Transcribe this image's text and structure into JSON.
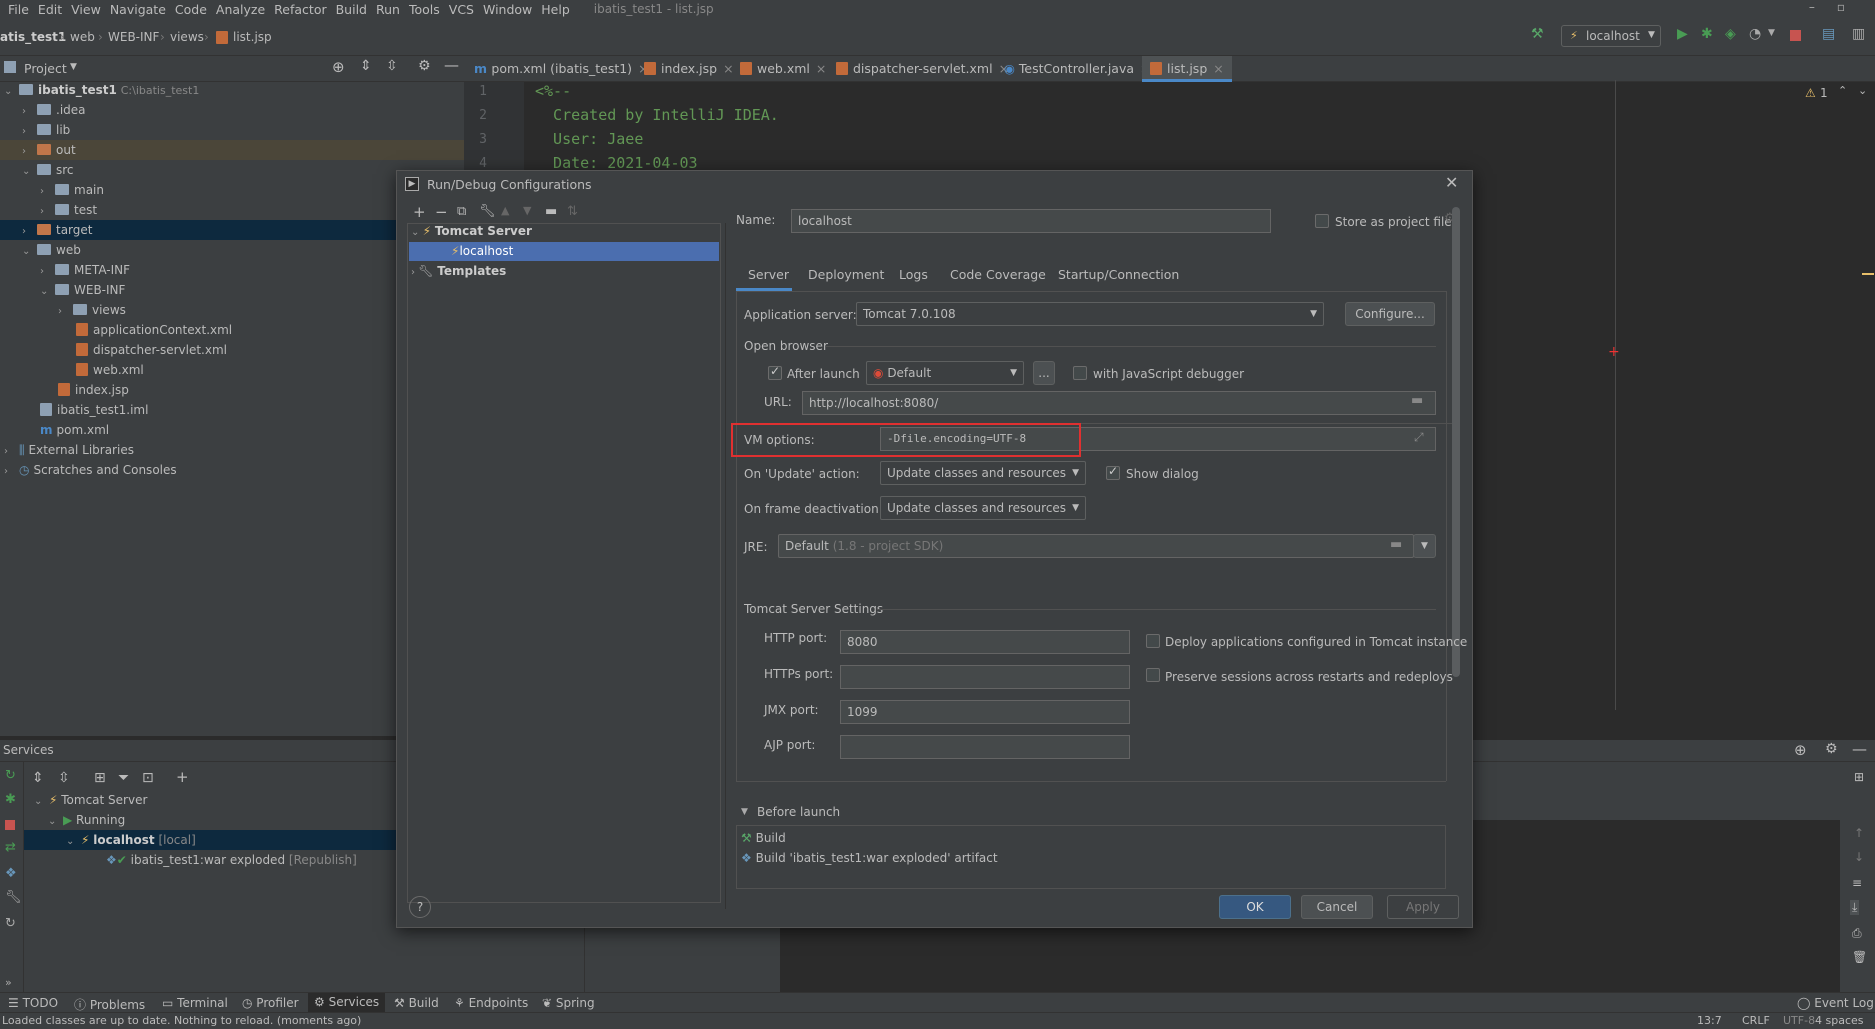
{
  "menu": [
    "File",
    "Edit",
    "View",
    "Navigate",
    "Code",
    "Analyze",
    "Refactor",
    "Build",
    "Run",
    "Tools",
    "VCS",
    "Window",
    "Help"
  ],
  "window_title": "ibatis_test1 - list.jsp",
  "breadcrumbs": [
    "atis_test1",
    "web",
    "WEB-INF",
    "views",
    "list.jsp"
  ],
  "run_config": "localhost",
  "project": {
    "title": "Project",
    "tree": [
      {
        "label": "ibatis_test1",
        "hint": "C:\\ibatis_test1"
      },
      {
        "label": ".idea"
      },
      {
        "label": "lib"
      },
      {
        "label": "out"
      },
      {
        "label": "src"
      },
      {
        "label": "main"
      },
      {
        "label": "test"
      },
      {
        "label": "target"
      },
      {
        "label": "web"
      },
      {
        "label": "META-INF"
      },
      {
        "label": "WEB-INF"
      },
      {
        "label": "views"
      },
      {
        "label": "applicationContext.xml"
      },
      {
        "label": "dispatcher-servlet.xml"
      },
      {
        "label": "web.xml"
      },
      {
        "label": "index.jsp"
      },
      {
        "label": "ibatis_test1.iml"
      },
      {
        "label": "pom.xml"
      },
      {
        "label": "External Libraries"
      },
      {
        "label": "Scratches and Consoles"
      }
    ]
  },
  "editor_tabs": [
    "pom.xml (ibatis_test1)",
    "index.jsp",
    "web.xml",
    "dispatcher-servlet.xml",
    "TestController.java",
    "list.jsp"
  ],
  "code_lines": [
    {
      "n": "1",
      "text": "<%--"
    },
    {
      "n": "2",
      "text": "  Created by IntelliJ IDEA."
    },
    {
      "n": "3",
      "text": "  User: Jaee"
    },
    {
      "n": "4",
      "text": "  Date: 2021-04-03"
    }
  ],
  "warning_count": "1",
  "services": {
    "title": "Services",
    "tree": [
      {
        "label": "Tomcat Server",
        "hint": ""
      },
      {
        "label": "Running",
        "hint": ""
      },
      {
        "label": "localhost",
        "hint": "[local]"
      },
      {
        "label": "ibatis_test1:war exploded",
        "hint": "[Republish]"
      }
    ]
  },
  "bottom_tools": [
    "TODO",
    "Problems",
    "Terminal",
    "Profiler",
    "Services",
    "Build",
    "Endpoints",
    "Spring"
  ],
  "event_log": "Event Log",
  "status": {
    "message": "Loaded classes are up to date. Nothing to reload. (moments ago)",
    "position": "13:7",
    "line_sep": "CRLF",
    "encoding": "UTF-8",
    "indent": "4 spaces"
  },
  "dialog": {
    "title": "Run/Debug Configurations",
    "left_tree": {
      "group": "Tomcat Server",
      "item": "localhost",
      "templates": "Templates"
    },
    "name_label": "Name:",
    "name_value": "localhost",
    "store_label": "Store as project file",
    "tabs": [
      "Server",
      "Deployment",
      "Logs",
      "Code Coverage",
      "Startup/Connection"
    ],
    "app_server_label": "Application server:",
    "app_server_value": "Tomcat 7.0.108",
    "configure_btn": "Configure...",
    "open_browser_label": "Open browser",
    "after_launch_label": "After launch",
    "browser_value": "Default",
    "ellipsis_btn": "...",
    "js_debugger_label": "with JavaScript debugger",
    "url_label": "URL:",
    "url_value": "http://localhost:8080/",
    "vm_label": "VM options:",
    "vm_value": "-Dfile.encoding=UTF-8",
    "update_label": "On 'Update' action:",
    "update_value": "Update classes and resources",
    "show_dialog_label": "Show dialog",
    "frame_label": "On frame deactivation:",
    "frame_value": "Update classes and resources",
    "jre_label": "JRE:",
    "jre_value": "Default",
    "jre_hint": "(1.8 - project SDK)",
    "tomcat_settings_label": "Tomcat Server Settings",
    "http_label": "HTTP port:",
    "http_value": "8080",
    "https_label": "HTTPs port:",
    "https_value": "",
    "jmx_label": "JMX port:",
    "jmx_value": "1099",
    "ajp_label": "AJP port:",
    "ajp_value": "",
    "deploy_label": "Deploy applications configured in Tomcat instance",
    "preserve_label": "Preserve sessions across restarts and redeploys",
    "before_launch_label": "Before launch",
    "before_items": [
      "Build",
      "Build 'ibatis_test1:war exploded' artifact"
    ],
    "ok": "OK",
    "cancel": "Cancel",
    "apply": "Apply",
    "help": "?"
  }
}
